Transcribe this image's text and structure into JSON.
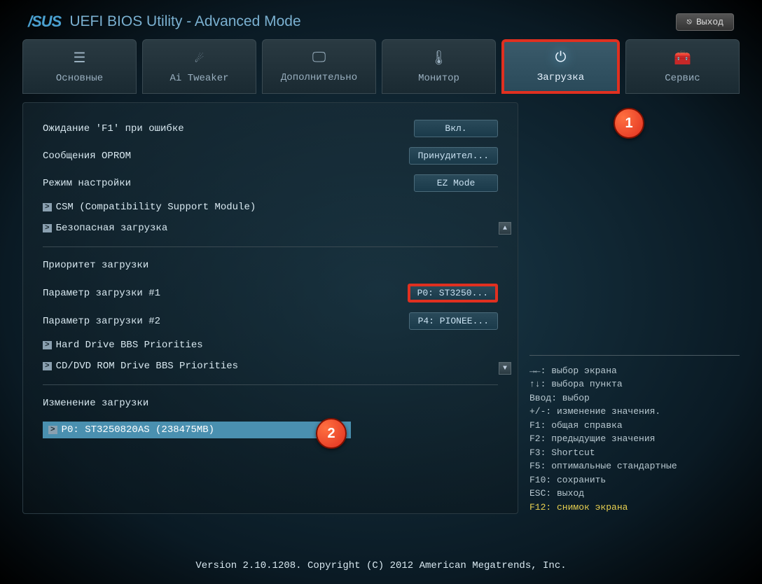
{
  "header": {
    "brand": "/SUS",
    "title": "UEFI BIOS Utility - Advanced Mode",
    "exit_label": "Выход"
  },
  "tabs": [
    {
      "label": "Основные",
      "icon": "list"
    },
    {
      "label": "Ai Tweaker",
      "icon": "tweaker"
    },
    {
      "label": "Дополнительно",
      "icon": "advanced"
    },
    {
      "label": "Монитор",
      "icon": "monitor"
    },
    {
      "label": "Загрузка",
      "icon": "power",
      "active": true
    },
    {
      "label": "Сервис",
      "icon": "tool"
    }
  ],
  "settings": {
    "wait_f1": {
      "label": "Ожидание 'F1' при ошибке",
      "value": "Вкл."
    },
    "oprom": {
      "label": "Сообщения OPROM",
      "value": "Принудител..."
    },
    "setup_mode": {
      "label": "Режим настройки",
      "value": "EZ Mode"
    },
    "csm": {
      "label": "CSM (Compatibility Support Module)"
    },
    "secure_boot": {
      "label": "Безопасная загрузка"
    },
    "boot_priority_title": "Приоритет загрузки",
    "boot_opt1": {
      "label": "Параметр загрузки #1",
      "value": "P0: ST3250..."
    },
    "boot_opt2": {
      "label": "Параметр загрузки #2",
      "value": "P4: PIONEE..."
    },
    "hdd_bbs": {
      "label": "Hard Drive BBS Priorities"
    },
    "cddvd_bbs": {
      "label": "CD/DVD ROM Drive BBS Priorities"
    },
    "boot_override_title": "Изменение загрузки",
    "boot_override_item": "P0: ST3250820AS  (238475MB)"
  },
  "badges": {
    "one": "1",
    "two": "2"
  },
  "help": {
    "l1": "→←: выбор экрана",
    "l2": "↑↓: выбора пункта",
    "l3": "Ввод: выбор",
    "l4": "+/-: изменение значения.",
    "l5": "F1: общая справка",
    "l6": "F2: предыдущие значения",
    "l7": "F3: Shortcut",
    "l8": "F5: оптимальные стандартные",
    "l9": "F10: сохранить",
    "l10": "ESC: выход",
    "l11": "F12: снимок экрана"
  },
  "footer": "Version 2.10.1208. Copyright (C) 2012 American Megatrends, Inc."
}
